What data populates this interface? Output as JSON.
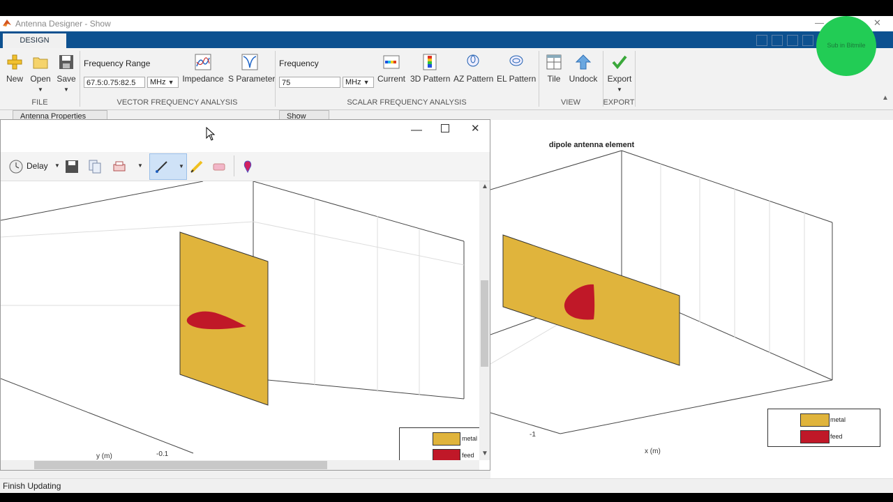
{
  "window": {
    "title": "Antenna Designer - Show"
  },
  "tabs": {
    "design": "DESIGN"
  },
  "overlay": {
    "label": "Sub in Bitmile"
  },
  "ribbon": {
    "file": {
      "section": "FILE",
      "new": "New",
      "open": "Open",
      "save": "Save"
    },
    "vfa": {
      "section": "VECTOR FREQUENCY ANALYSIS",
      "range_label": "Frequency Range",
      "range_value": "67.5:0.75:82.5",
      "range_unit": "MHz",
      "impedance": "Impedance",
      "sparam": "S Parameter"
    },
    "sfa": {
      "section": "SCALAR FREQUENCY ANALYSIS",
      "freq_label": "Frequency",
      "freq_value": "75",
      "freq_unit": "MHz",
      "current": "Current",
      "pattern3d": "3D Pattern",
      "az": "AZ Pattern",
      "el": "EL Pattern"
    },
    "view": {
      "section": "VIEW",
      "tile": "Tile",
      "undock": "Undock"
    },
    "export": {
      "section": "EXPORT",
      "export": "Export"
    }
  },
  "panels": {
    "props": "Antenna Properties",
    "show": "Show"
  },
  "float": {
    "delay": "Delay",
    "legend": {
      "metal": "metal",
      "feed": "feed"
    },
    "axis": {
      "ylabel": "y (m)",
      "tick": "-0.1"
    }
  },
  "main_plot": {
    "title": "dipole antenna element",
    "xlabel": "x (m)",
    "tick": "-1",
    "legend": {
      "metal": "metal",
      "feed": "feed"
    }
  },
  "colors": {
    "metal": "#e0b43c",
    "feed": "#c01828",
    "ribbon_tab": "#0d5190"
  },
  "status": {
    "text": "Finish Updating"
  }
}
